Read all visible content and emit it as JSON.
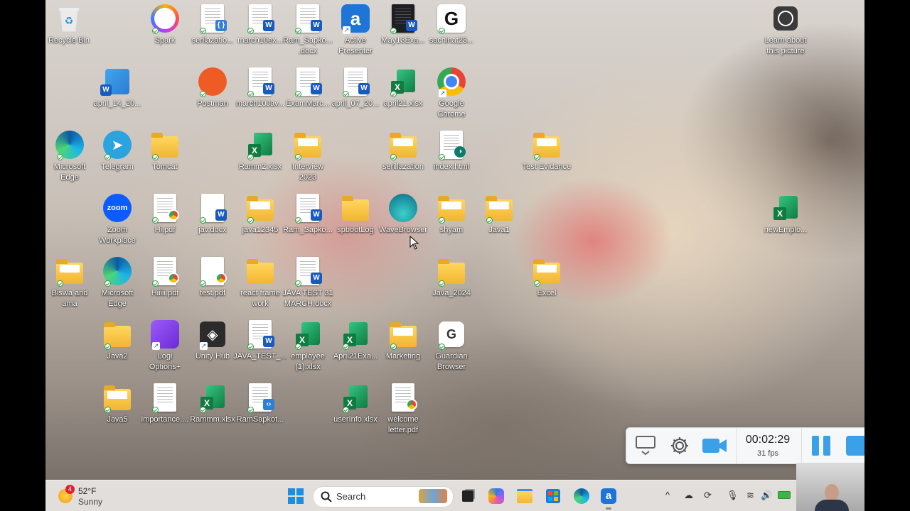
{
  "desktop": {
    "icons": [
      {
        "label": "Recycle Bin"
      },
      {
        "label": "Spark"
      },
      {
        "label": "serilazatio..."
      },
      {
        "label": "march10ex..."
      },
      {
        "label": "Ram_Sapko...\n.docx"
      },
      {
        "label": "Active\nPresenter"
      },
      {
        "label": "May13Exa..."
      },
      {
        "label": "sachinat23..."
      },
      {
        "label": "Learn about\nthis picture"
      },
      {
        "label": "april_14_20..."
      },
      {
        "label": "Postman"
      },
      {
        "label": "march10Jav..."
      },
      {
        "label": "ExamMarc..."
      },
      {
        "label": "april_07_20..."
      },
      {
        "label": "april21.xlsx"
      },
      {
        "label": "Google\nChrome"
      },
      {
        "label": "Microsoft\nEdge"
      },
      {
        "label": "Telegram"
      },
      {
        "label": "Tomcat"
      },
      {
        "label": "Ramm2.xlsx"
      },
      {
        "label": "Interview\n2023"
      },
      {
        "label": "serillazation"
      },
      {
        "label": "index.html"
      },
      {
        "label": "Test Evidance"
      },
      {
        "label": "Zoom\nWorkplace"
      },
      {
        "label": "Hi.pdf"
      },
      {
        "label": "jav.docx"
      },
      {
        "label": "java12345"
      },
      {
        "label": "Ram_Sapko..."
      },
      {
        "label": "spbootLog"
      },
      {
        "label": "WaveBrowser"
      },
      {
        "label": "shyam"
      },
      {
        "label": "Java1"
      },
      {
        "label": "newEmplo..."
      },
      {
        "label": "Biswa and\nama"
      },
      {
        "label": "Microsoft\nEdge"
      },
      {
        "label": "Hiiiii.pdf"
      },
      {
        "label": "test.pdf"
      },
      {
        "label": "react frame\nwork"
      },
      {
        "label": "JAVA TEST 31\nMARCH.docx"
      },
      {
        "label": "Java_2024"
      },
      {
        "label": "Excel"
      },
      {
        "label": "Java2"
      },
      {
        "label": "Logi\nOptions+"
      },
      {
        "label": "Unity Hub"
      },
      {
        "label": "JAVA_TEST_..."
      },
      {
        "label": "employee\n(1).xlsx"
      },
      {
        "label": "April21Exa..."
      },
      {
        "label": "Marketing"
      },
      {
        "label": "Guardian\nBrowser"
      },
      {
        "label": "Java5"
      },
      {
        "label": "importance...."
      },
      {
        "label": "Rammm.xlsx"
      },
      {
        "label": "RamSapkot..."
      },
      {
        "label": "userInfo.xlsx"
      },
      {
        "label": "welcome\nletter.pdf"
      }
    ]
  },
  "recorder": {
    "timer": "00:02:29",
    "fps": "31 fps"
  },
  "taskbar": {
    "weather": {
      "temp": "52°F",
      "condition": "Sunny",
      "badge": "4"
    },
    "search_label": "Search"
  },
  "colors": {
    "accent": "#1a73e8",
    "taskbar_bg": "#ece8e6",
    "recorder_icon": "#3aa0e8"
  }
}
